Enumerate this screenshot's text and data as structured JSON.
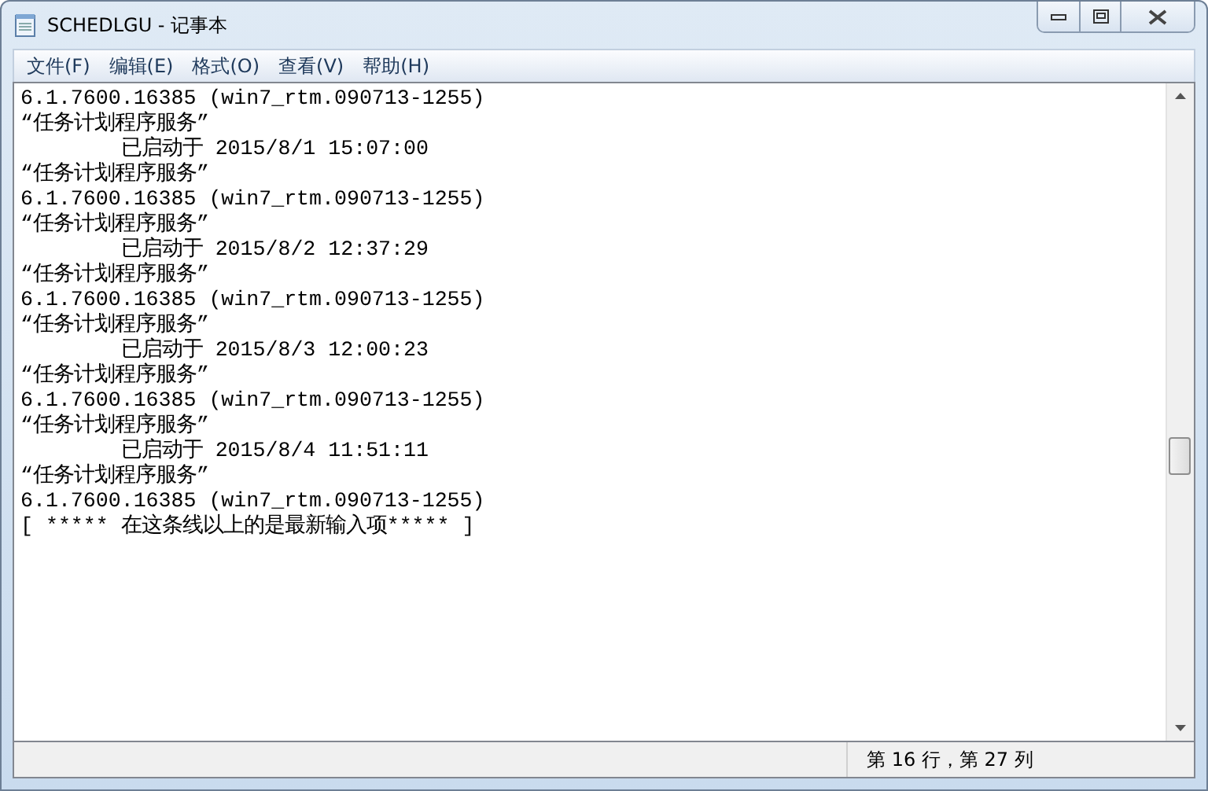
{
  "window": {
    "title": "SCHEDLGU - 记事本"
  },
  "menu": [
    "文件(F)",
    "编辑(E)",
    "格式(O)",
    "查看(V)",
    "帮助(H)"
  ],
  "document": {
    "lines": [
      "6.1.7600.16385 (win7_rtm.090713-1255)",
      "“任务计划程序服务”",
      "\t已启动于 2015/8/1 15:07:00",
      "“任务计划程序服务”",
      "6.1.7600.16385 (win7_rtm.090713-1255)",
      "“任务计划程序服务”",
      "\t已启动于 2015/8/2 12:37:29",
      "“任务计划程序服务”",
      "6.1.7600.16385 (win7_rtm.090713-1255)",
      "“任务计划程序服务”",
      "\t已启动于 2015/8/3 12:00:23",
      "“任务计划程序服务”",
      "6.1.7600.16385 (win7_rtm.090713-1255)",
      "“任务计划程序服务”",
      "\t已启动于 2015/8/4 11:51:11",
      "“任务计划程序服务”",
      "6.1.7600.16385 (win7_rtm.090713-1255)",
      "[ ***** 在这条线以上的是最新输入项***** ]"
    ]
  },
  "status_bar": {
    "position": "第 16 行，第 27 列"
  }
}
